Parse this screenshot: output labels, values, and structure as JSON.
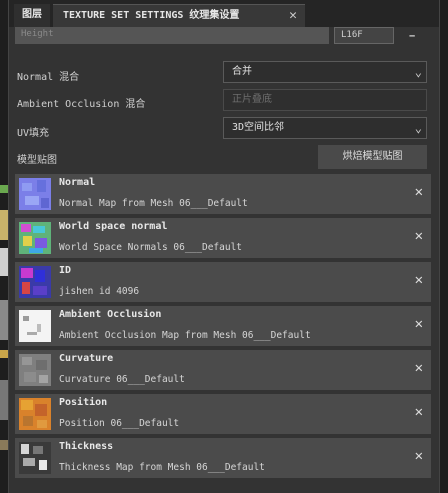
{
  "tabs": [
    {
      "label": "图层"
    },
    {
      "label": "TEXTURE SET SETTINGS 纹理集设置"
    }
  ],
  "height_row": {
    "label": "Height",
    "select_value": "L16F",
    "collapse": "−"
  },
  "fields": {
    "normal_mix": {
      "label": "Normal 混合",
      "value": "合并"
    },
    "ao_mix": {
      "label": "Ambient Occlusion 混合",
      "placeholder": "正片叠底"
    },
    "uv_fill": {
      "label": "UV填充",
      "value": "3D空间比邻"
    }
  },
  "mesh_maps": {
    "label": "模型贴图",
    "bake_button": "烘焙模型贴图"
  },
  "maps": [
    {
      "title": "Normal",
      "subtitle": "Normal Map from Mesh 06___Default",
      "thumb_icon": "normal-map-thumbnail"
    },
    {
      "title": "World space normal",
      "subtitle": "World Space Normals 06___Default",
      "thumb_icon": "world-space-normal-thumbnail"
    },
    {
      "title": "ID",
      "subtitle": "jishen  id 4096",
      "thumb_icon": "id-map-thumbnail"
    },
    {
      "title": "Ambient Occlusion",
      "subtitle": "Ambient Occlusion Map from Mesh 06___Default",
      "thumb_icon": "ao-map-thumbnail"
    },
    {
      "title": "Curvature",
      "subtitle": "Curvature 06___Default",
      "thumb_icon": "curvature-map-thumbnail"
    },
    {
      "title": "Position",
      "subtitle": "Position 06___Default",
      "thumb_icon": "position-map-thumbnail"
    },
    {
      "title": "Thickness",
      "subtitle": "Thickness Map from Mesh 06___Default",
      "thumb_icon": "thickness-map-thumbnail"
    }
  ],
  "colors": {
    "panel": "#333333",
    "item": "#4b4b4b",
    "text": "#d0d0d0"
  }
}
